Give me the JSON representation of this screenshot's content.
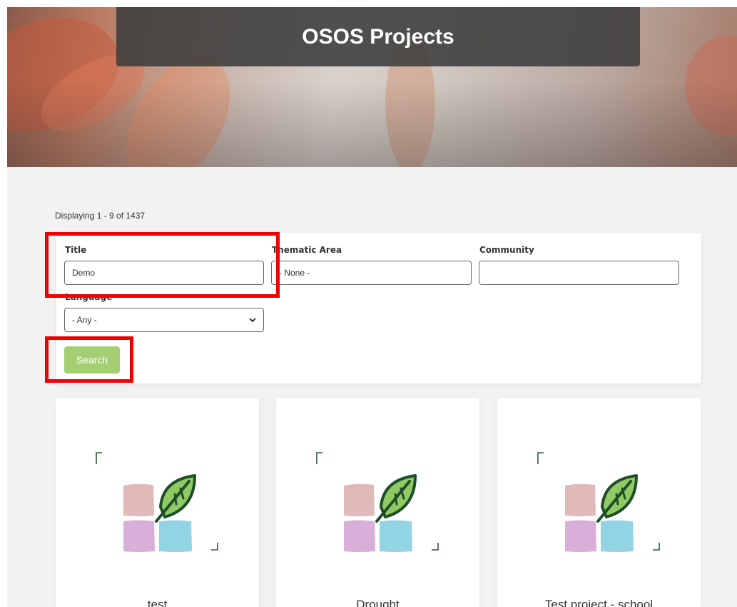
{
  "hero": {
    "title": "OSOS Projects"
  },
  "results": {
    "count_text": "Displaying 1 - 9 of 1437"
  },
  "filters": {
    "title_label": "Title",
    "title_value": "Demo",
    "thematic_label": "Thematic Area",
    "thematic_value": "- None -",
    "community_label": "Community",
    "community_value": "",
    "language_label": "Language",
    "language_value": "- Any -",
    "search_label": "Search"
  },
  "cards": [
    {
      "title": "test"
    },
    {
      "title": "Drought"
    },
    {
      "title": "Test project - school"
    }
  ],
  "colors": {
    "accent_green": "#a3cf72",
    "highlight_red": "#f00000",
    "banner": "#3c3c3c"
  }
}
